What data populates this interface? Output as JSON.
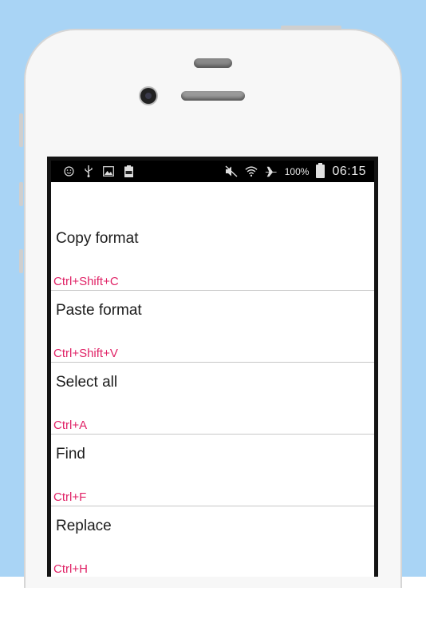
{
  "status_bar": {
    "left_icons": [
      "smiley-icon",
      "usb-icon",
      "image-icon",
      "battery-100-icon"
    ],
    "right_icons": [
      "mute-icon",
      "wifi-icon",
      "airplane-icon"
    ],
    "battery_text": "100%",
    "time": "06:15"
  },
  "menu": {
    "items": [
      {
        "label": "Copy format",
        "shortcut": "Ctrl+Shift+C"
      },
      {
        "label": "Paste format",
        "shortcut": "Ctrl+Shift+V"
      },
      {
        "label": "Select all",
        "shortcut": "Ctrl+A"
      },
      {
        "label": "Find",
        "shortcut": "Ctrl+F"
      },
      {
        "label": "Replace",
        "shortcut": "Ctrl+H"
      }
    ]
  },
  "colors": {
    "background": "#a9d4f5",
    "shortcut": "#e02266",
    "status_bar": "#000000"
  }
}
